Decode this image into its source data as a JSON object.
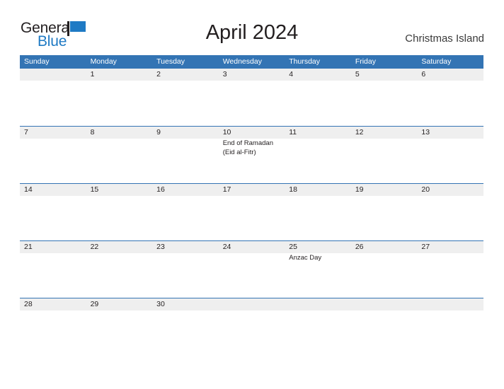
{
  "logo": {
    "word_one": "General",
    "word_two": "Blue",
    "flag_icon": "blue-flag-triangle-icon",
    "blue": "#1f7ac4",
    "black": "#231f20"
  },
  "header": {
    "title": "April 2024",
    "locale": "Christmas Island"
  },
  "theme": {
    "header_blue": "#3374b4",
    "band_gray": "#efefef",
    "text": "#231f20",
    "white": "#ffffff"
  },
  "calendar": {
    "day_headers": [
      "Sunday",
      "Monday",
      "Tuesday",
      "Wednesday",
      "Thursday",
      "Friday",
      "Saturday"
    ],
    "weeks": [
      {
        "days": [
          {
            "num": "",
            "events": []
          },
          {
            "num": "1",
            "events": []
          },
          {
            "num": "2",
            "events": []
          },
          {
            "num": "3",
            "events": []
          },
          {
            "num": "4",
            "events": []
          },
          {
            "num": "5",
            "events": []
          },
          {
            "num": "6",
            "events": []
          }
        ]
      },
      {
        "days": [
          {
            "num": "7",
            "events": []
          },
          {
            "num": "8",
            "events": []
          },
          {
            "num": "9",
            "events": []
          },
          {
            "num": "10",
            "events": [
              "End of Ramadan",
              "(Eid al-Fitr)"
            ]
          },
          {
            "num": "11",
            "events": []
          },
          {
            "num": "12",
            "events": []
          },
          {
            "num": "13",
            "events": []
          }
        ]
      },
      {
        "days": [
          {
            "num": "14",
            "events": []
          },
          {
            "num": "15",
            "events": []
          },
          {
            "num": "16",
            "events": []
          },
          {
            "num": "17",
            "events": []
          },
          {
            "num": "18",
            "events": []
          },
          {
            "num": "19",
            "events": []
          },
          {
            "num": "20",
            "events": []
          }
        ]
      },
      {
        "days": [
          {
            "num": "21",
            "events": []
          },
          {
            "num": "22",
            "events": []
          },
          {
            "num": "23",
            "events": []
          },
          {
            "num": "24",
            "events": []
          },
          {
            "num": "25",
            "events": [
              "Anzac Day"
            ]
          },
          {
            "num": "26",
            "events": []
          },
          {
            "num": "27",
            "events": []
          }
        ]
      },
      {
        "days": [
          {
            "num": "28",
            "events": []
          },
          {
            "num": "29",
            "events": []
          },
          {
            "num": "30",
            "events": []
          },
          {
            "num": "",
            "events": []
          },
          {
            "num": "",
            "events": []
          },
          {
            "num": "",
            "events": []
          },
          {
            "num": "",
            "events": []
          }
        ]
      }
    ]
  }
}
